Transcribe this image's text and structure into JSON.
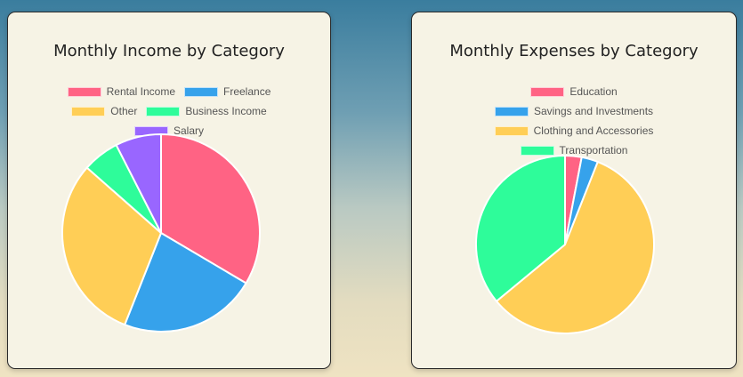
{
  "chart_data": [
    {
      "type": "pie",
      "title": "Monthly Income by Category",
      "categories": [
        "Rental Income",
        "Freelance",
        "Other",
        "Business Income",
        "Salary"
      ],
      "values": [
        33.5,
        22.5,
        30.5,
        6,
        7.5
      ],
      "colors": [
        "#ff6384",
        "#36a2eb",
        "#ffce56",
        "#2efc9a",
        "#9966ff"
      ],
      "legend_rows": [
        [
          "Rental Income",
          "Freelance"
        ],
        [
          "Other",
          "Business Income"
        ],
        [
          "Salary"
        ]
      ],
      "legend_position": "top"
    },
    {
      "type": "pie",
      "title": "Monthly Expenses by Category",
      "categories": [
        "Education",
        "Savings and Investments",
        "Clothing and Accessories",
        "Transportation"
      ],
      "values": [
        3,
        3,
        58,
        36
      ],
      "colors": [
        "#ff6384",
        "#36a2eb",
        "#ffce56",
        "#2efc9a"
      ],
      "legend_rows": [
        [
          "Education"
        ],
        [
          "Savings and Investments"
        ],
        [
          "Clothing and Accessories"
        ],
        [
          "Transportation"
        ]
      ],
      "legend_position": "top"
    }
  ]
}
